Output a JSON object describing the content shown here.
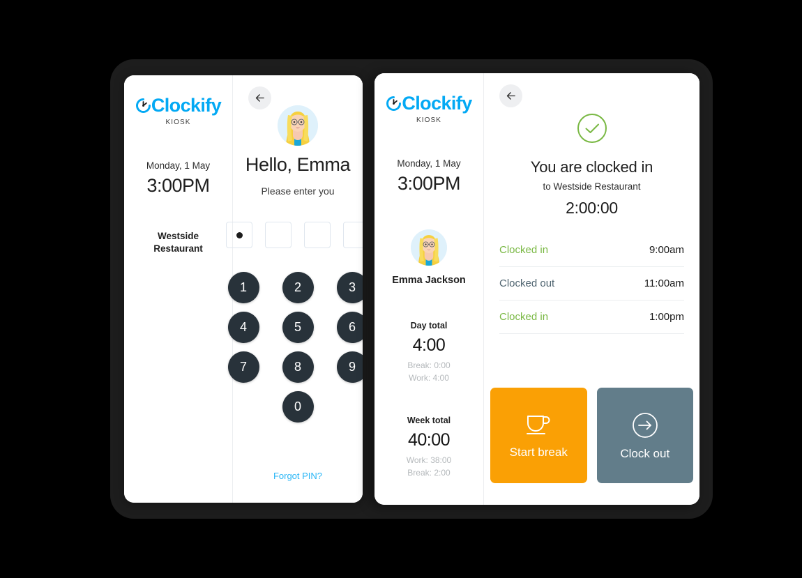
{
  "brand": {
    "name": "Clockify",
    "subtitle": "KIOSK",
    "logo_icon": "clock-logo-icon",
    "accent_color": "#03a9f4"
  },
  "colors": {
    "keypad": "#28323a",
    "link": "#29b6f6",
    "success_green": "#79b843",
    "clocked_out_slate": "#4f6470",
    "break_orange": "#faa005",
    "clockout_slate": "#627d8a",
    "device_bezel": "#1d1d1d",
    "page_background": "#000000"
  },
  "screen_one": {
    "sidebar": {
      "date": "Monday, 1 May",
      "time": "3:00PM",
      "workspace_line1": "Westside",
      "workspace_line2": "Restaurant"
    },
    "back_button": {
      "icon": "arrow-left-icon",
      "label": ""
    },
    "pin_screen": {
      "avatar_icon": "user-avatar-emma",
      "greeting": "Hello, Emma",
      "instruction": "Please enter you",
      "pin_boxes": [
        {
          "filled": true
        },
        {
          "filled": false
        },
        {
          "filled": false
        },
        {
          "filled": false
        }
      ],
      "keypad": [
        "1",
        "2",
        "3",
        "4",
        "5",
        "6",
        "7",
        "8",
        "9",
        "",
        "0",
        ""
      ],
      "forgot_pin_label": "Forgot PIN?"
    }
  },
  "screen_two": {
    "sidebar": {
      "date": "Monday, 1 May",
      "time": "3:00PM",
      "avatar_icon": "user-avatar-emma",
      "user_name": "Emma Jackson",
      "day_total": {
        "label": "Day total",
        "value": "4:00",
        "sub1": "Break: 0:00",
        "sub2": "Work: 4:00"
      },
      "week_total": {
        "label": "Week total",
        "value": "40:00",
        "sub1": "Work: 38:00",
        "sub2": "Break: 2:00"
      }
    },
    "back_button": {
      "icon": "arrow-left-icon",
      "label": ""
    },
    "status": {
      "status_icon": "check-circle-icon",
      "title": "You are clocked in",
      "subtitle": "to Westside Restaurant",
      "timer": "2:00:00"
    },
    "log": [
      {
        "label": "Clocked in",
        "state": "in",
        "time": "9:00am"
      },
      {
        "label": "Clocked out",
        "state": "out",
        "time": "11:00am"
      },
      {
        "label": "Clocked in",
        "state": "in",
        "time": "1:00pm"
      }
    ],
    "actions": [
      {
        "label": "Start break",
        "icon": "coffee-cup-icon",
        "color": "#faa005"
      },
      {
        "label": "Clock out",
        "icon": "arrow-exit-icon",
        "color": "#627d8a"
      }
    ]
  }
}
